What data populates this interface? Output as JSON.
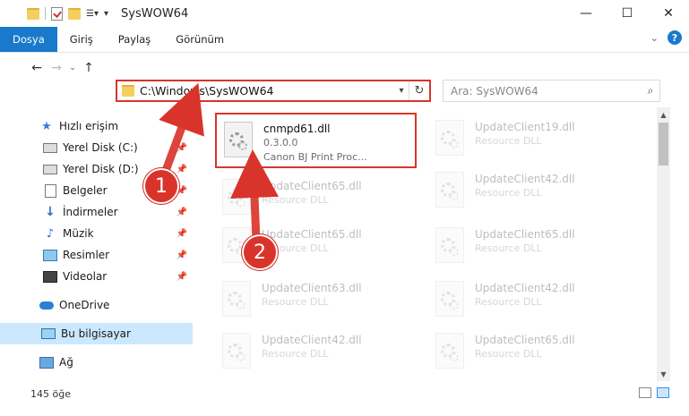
{
  "window": {
    "title": "SysWOW64",
    "minimize": "—",
    "maximize": "☐",
    "close": "✕"
  },
  "ribbon": {
    "tabs": [
      {
        "label": "Dosya",
        "active": true
      },
      {
        "label": "Giriş"
      },
      {
        "label": "Paylaş"
      },
      {
        "label": "Görünüm"
      }
    ],
    "help": "?"
  },
  "nav": {
    "back": "←",
    "forward": "→",
    "recent": "⌄",
    "up": "↑",
    "address": "C:\\Windows\\SysWOW64",
    "refresh": "↻",
    "search_placeholder": "Ara: SysWOW64"
  },
  "sidebar": {
    "quick_access": "Hızlı erişim",
    "items": [
      {
        "label": "Yerel Disk (C:)"
      },
      {
        "label": "Yerel Disk (D:)"
      },
      {
        "label": "Belgeler"
      },
      {
        "label": "İndirmeler"
      },
      {
        "label": "Müzik"
      },
      {
        "label": "Resimler"
      },
      {
        "label": "Videolar"
      }
    ],
    "onedrive": "OneDrive",
    "this_pc": "Bu bilgisayar",
    "network": "Ağ"
  },
  "files": [
    {
      "name": "cnmpd61.dll",
      "line2": "0.3.0.0",
      "line3": "Canon BJ Print Proc...",
      "highlight": true
    },
    {
      "name": "UpdateClient19.dll",
      "line2": "Resource DLL"
    },
    {
      "name": "UpdateClient65.dll",
      "line2": "Resource DLL"
    },
    {
      "name": "UpdateClient42.dll",
      "line2": "Resource DLL"
    },
    {
      "name": "UpdateClient65.dll",
      "line2": "Resource DLL"
    },
    {
      "name": "UpdateClient65.dll",
      "line2": "Resource DLL"
    },
    {
      "name": "UpdateClient63.dll",
      "line2": "Resource DLL"
    },
    {
      "name": "UpdateClient42.dll",
      "line2": "Resource DLL"
    },
    {
      "name": "UpdateClient42.dll",
      "line2": "Resource DLL"
    },
    {
      "name": "UpdateClient65.dll",
      "line2": "Resource DLL"
    }
  ],
  "status": {
    "count": "145 öğe"
  },
  "annotations": {
    "step1": "1",
    "step2": "2",
    "color": "#d9342b"
  }
}
